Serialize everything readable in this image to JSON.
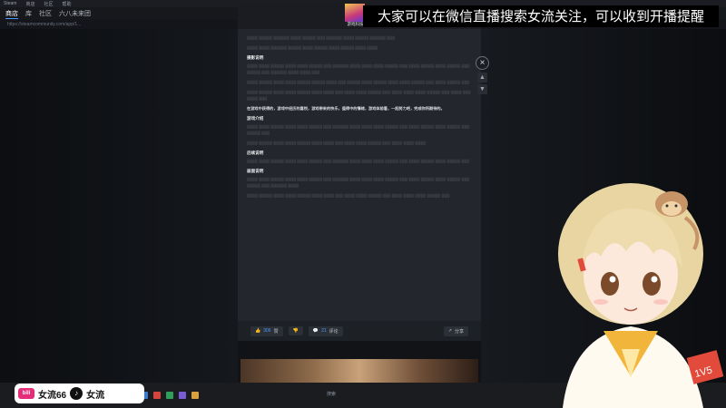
{
  "browser": {
    "title_items": [
      "Steam",
      "商店",
      "社区",
      "帮助"
    ],
    "nav": [
      "商店",
      "库",
      "社区",
      "六八未来团"
    ],
    "url": "https://steamcommunity.com/app/1..."
  },
  "banner": {
    "text": "大家可以在微信直播搜索女流关注，可以收到开播提醒"
  },
  "article": {
    "cover_caption": "游戏科技讨论",
    "section1_title": "摄影说明",
    "section2_title": "游戏介绍",
    "section3_title": "后续说明",
    "section4_title": "画面说明",
    "highlight": "在游戏中获得的，游戏中经历的喜悦，游戏带来的快乐，值得中的情绪，游戏体验着，一起努力吧，完成你所期待的。"
  },
  "footer": {
    "likes": "306",
    "like_label": "赞",
    "dislike_label": "踩",
    "comments": "21",
    "comment_label": "评论",
    "share_label": "分享"
  },
  "social": {
    "bili_logo": "bili",
    "bili_name": "女流66",
    "tiktok_name": "女流"
  },
  "taskbar": {
    "center_text": "搜索"
  }
}
